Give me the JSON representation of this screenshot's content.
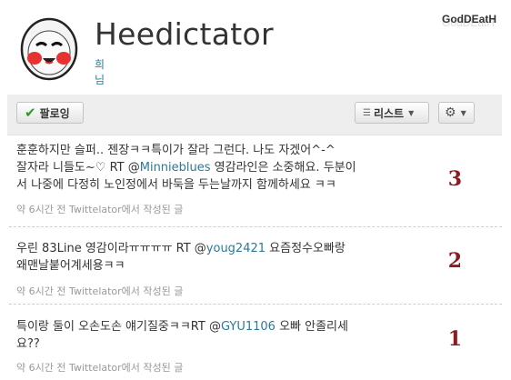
{
  "watermark": "GodDEatH",
  "profile": {
    "name": "Heedictator",
    "realname": "희님"
  },
  "toolbar": {
    "follow_label": "팔로잉",
    "list_label": "리스트"
  },
  "tweets": [
    {
      "line1": "훈훈하지만 슬퍼.. 젠장ㅋㅋ특이가 잘라 그런다. 나도 자겠어^-^",
      "line2_pre": "잘자라 니들도~♡ RT @",
      "mention": "Minnieblues",
      "line2_post": " 영감라인은 소중해요. 두분이",
      "line3": "서 나중에 다정히 노인정에서 바둑을 두는날까지 함께하세요 ㅋㅋ",
      "meta": "약 6시간 전 Twittelator에서 작성된 글",
      "number": "3"
    },
    {
      "line1_pre": "우린 83Line 영감이라ㅠㅠㅠㅠ RT @",
      "mention": "youg2421",
      "line1_post": " 요즘정수오빠랑",
      "line2": "왜맨날붙어계세용ㅋㅋ",
      "meta": "약 6시간 전 Twittelator에서 작성된 글",
      "number": "2"
    },
    {
      "line1_pre": "특이랑 둘이 오손도손 얘기질중ㅋㅋRT @",
      "mention": "GYU1106",
      "line1_post": " 오빠 안졸리세",
      "line2": "요??",
      "meta": "약 6시간 전 Twittelator에서 작성된 글",
      "number": "1"
    }
  ]
}
